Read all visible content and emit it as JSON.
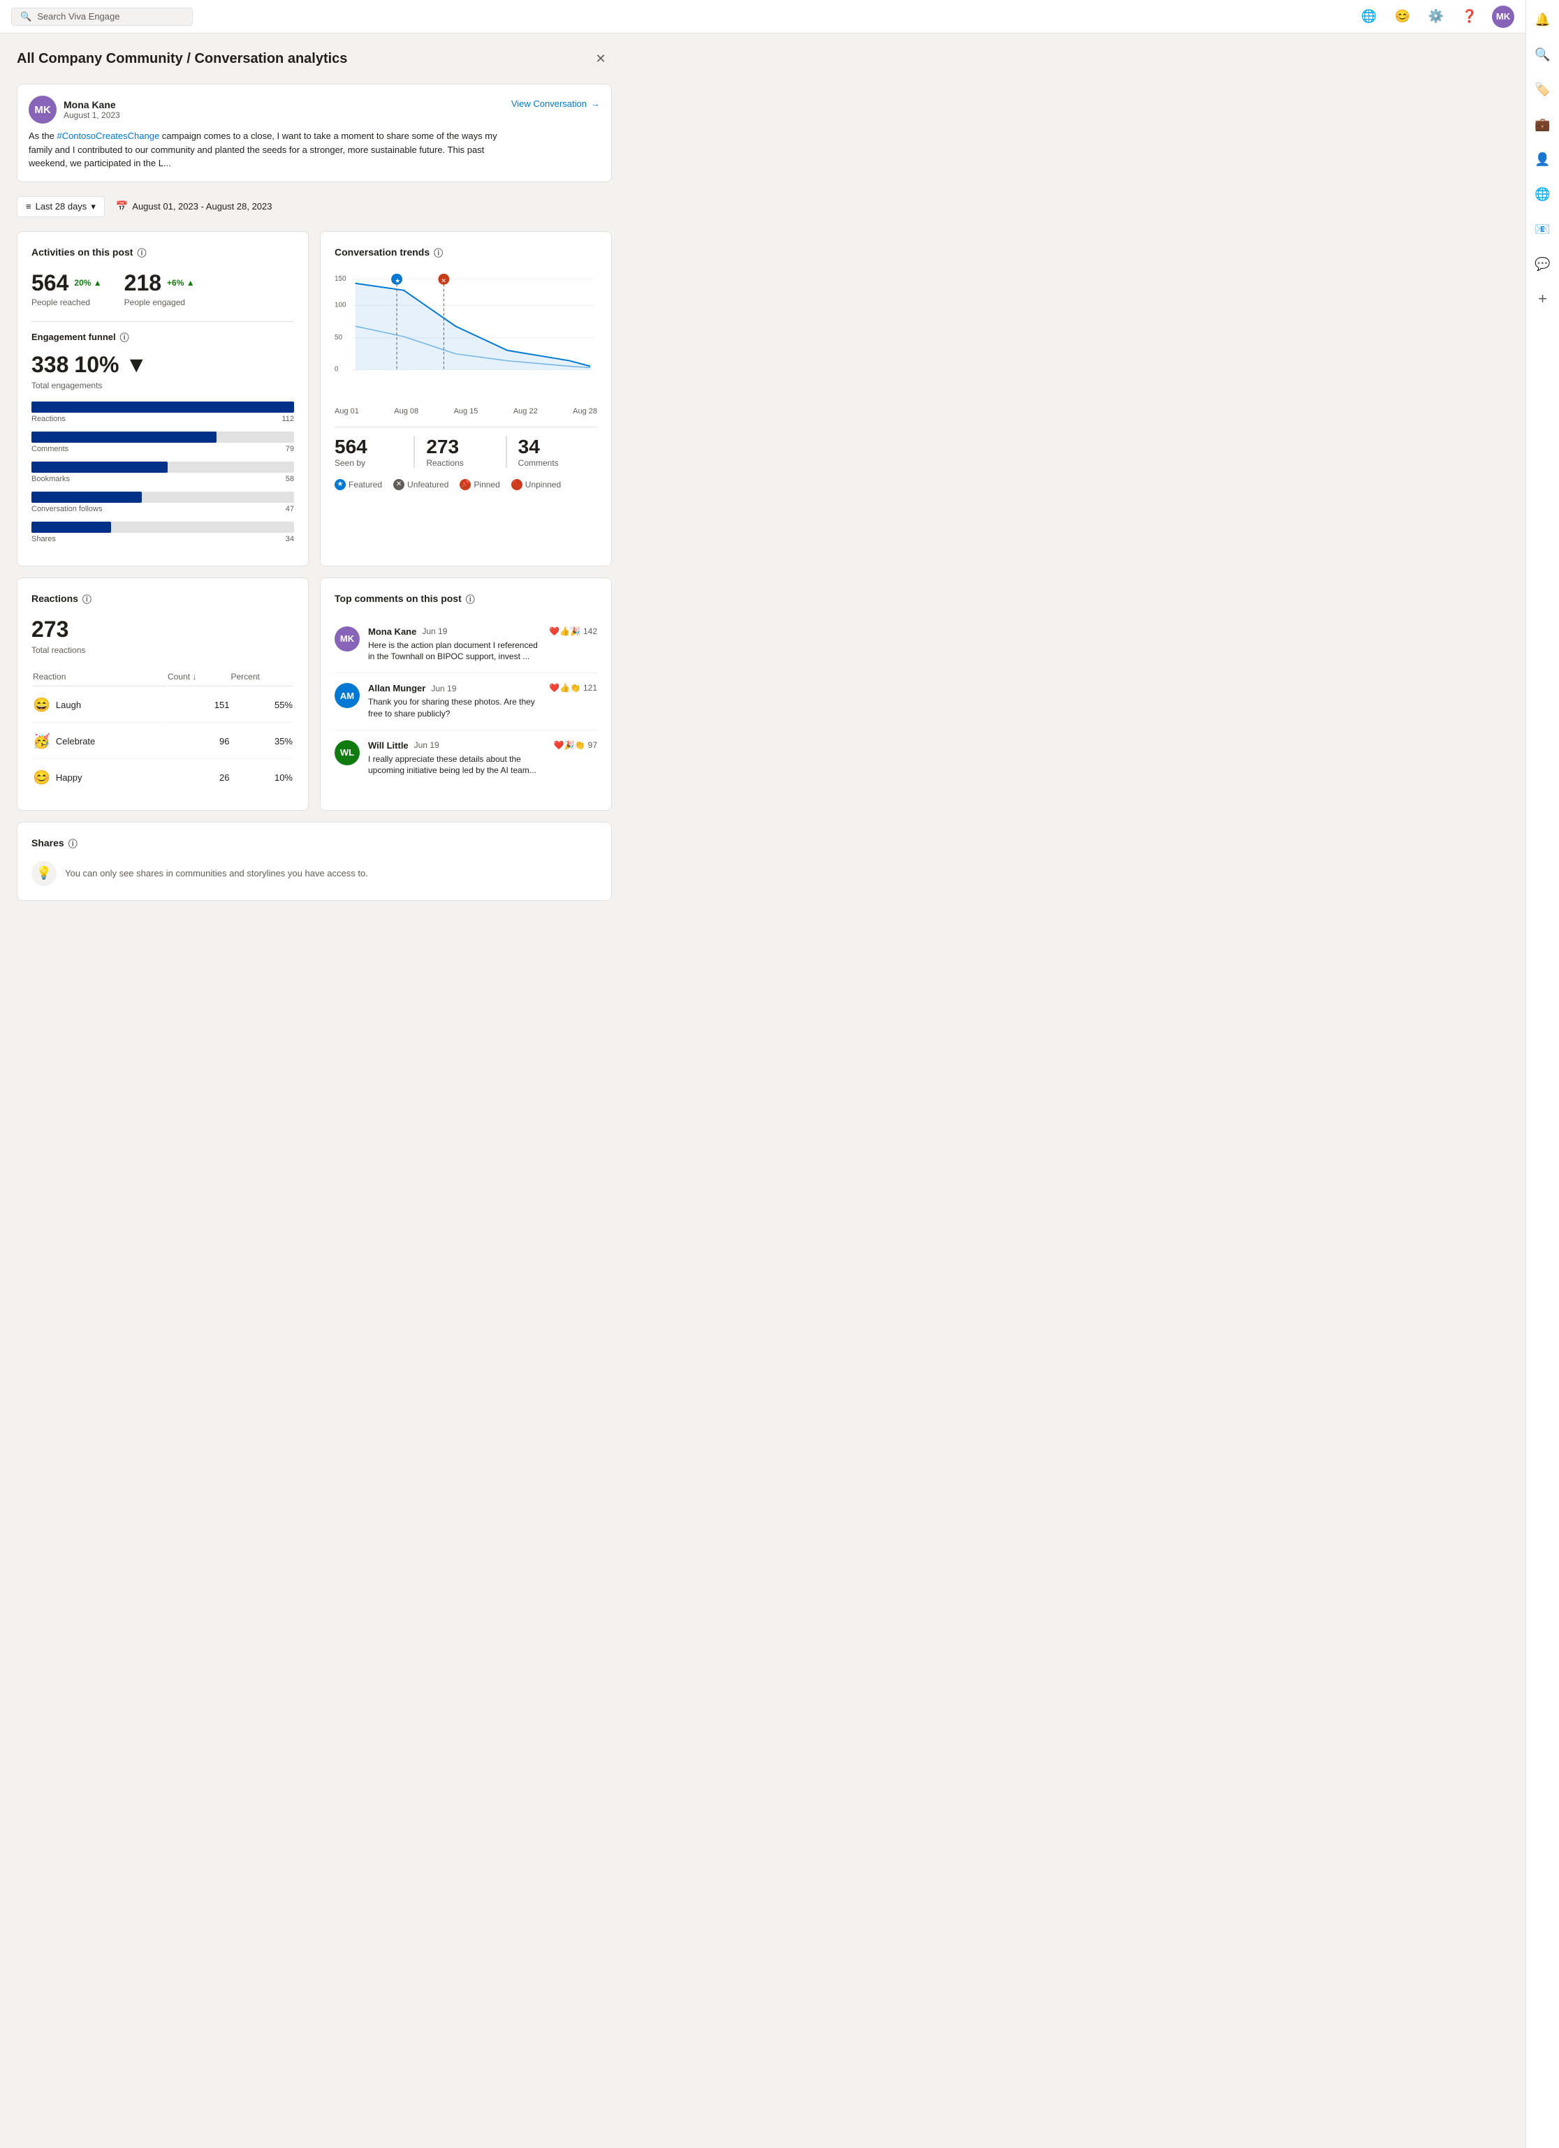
{
  "topNav": {
    "searchPlaceholder": "Search Viva Engage"
  },
  "pageTitle": "All Company Community / Conversation analytics",
  "postCard": {
    "authorName": "Mona Kane",
    "postDate": "August 1, 2023",
    "postText": "As the #ContosoCreatesChange campaign comes to a close, I want to take a moment to share some of the ways my family and I contributed to our community and planted the seeds for a stronger, more sustainable future. This past weekend, we participated in the L...",
    "hashtag": "#ContosoCreatesChange",
    "viewConversationLabel": "View Conversation"
  },
  "filterBar": {
    "periodLabel": "Last 28 days",
    "dateRange": "August 01, 2023 - August 28, 2023"
  },
  "activitiesCard": {
    "title": "Activities on this post",
    "peopleReached": "564",
    "peopleReachedChange": "20%",
    "peopleReachedChangeDir": "up",
    "peopleReachedLabel": "People reached",
    "peopleEngaged": "218",
    "peopleEngagedChange": "+6%",
    "peopleEngagedChangeDir": "up",
    "peopleEngagedLabel": "People engaged",
    "funnelTitle": "Engagement funnel",
    "totalEngagements": "338",
    "totalEngagementsChange": "10%",
    "totalEngagementsChangeDir": "down",
    "totalEngagementsLabel": "Total engagements",
    "bars": [
      {
        "label": "Reactions",
        "value": 112,
        "maxValue": 112,
        "displayValue": "112"
      },
      {
        "label": "Comments",
        "value": 79,
        "maxValue": 112,
        "displayValue": "79"
      },
      {
        "label": "Bookmarks",
        "value": 58,
        "maxValue": 112,
        "displayValue": "58"
      },
      {
        "label": "Conversation follows",
        "value": 47,
        "maxValue": 112,
        "displayValue": "47"
      },
      {
        "label": "Shares",
        "value": 34,
        "maxValue": 112,
        "displayValue": "34"
      }
    ]
  },
  "trendsCard": {
    "title": "Conversation trends",
    "chartLabels": [
      "Aug 01",
      "Aug 08",
      "Aug 15",
      "Aug 22",
      "Aug 28"
    ],
    "chartYLabels": [
      "150",
      "100",
      "50",
      "0"
    ],
    "seenBy": "564",
    "seenByLabel": "Seen by",
    "reactions": "273",
    "reactionsLabel": "Reactions",
    "comments": "34",
    "commentsLabel": "Comments",
    "legend": [
      {
        "type": "featured",
        "label": "Featured",
        "icon": "★"
      },
      {
        "type": "unfeatured",
        "label": "Unfeatured",
        "icon": "✕"
      },
      {
        "type": "pinned",
        "label": "Pinned",
        "icon": "📌"
      },
      {
        "type": "unpinned",
        "label": "Unpinned",
        "icon": "🚫"
      }
    ]
  },
  "reactionsCard": {
    "title": "Reactions",
    "totalReactions": "273",
    "totalReactionsLabel": "Total reactions",
    "tableHeaders": {
      "reaction": "Reaction",
      "count": "Count",
      "percent": "Percent"
    },
    "rows": [
      {
        "emoji": "😄",
        "name": "Laugh",
        "count": "151",
        "percent": "55%"
      },
      {
        "emoji": "🥳",
        "name": "Celebrate",
        "count": "96",
        "percent": "35%"
      },
      {
        "emoji": "😊",
        "name": "Happy",
        "count": "26",
        "percent": "10%"
      }
    ]
  },
  "topCommentsCard": {
    "title": "Top comments on this post",
    "comments": [
      {
        "author": "Mona Kane",
        "date": "Jun 19",
        "text": "Here is the action plan document I referenced in the Townhall on BIPOC support, invest ...",
        "reactions": "❤️👍🎉",
        "reactionCount": "142",
        "avatarColor": "#8764b8",
        "initials": "MK"
      },
      {
        "author": "Allan Munger",
        "date": "Jun 19",
        "text": "Thank you for sharing these photos. Are they free to share publicly?",
        "reactions": "❤️👍👏",
        "reactionCount": "121",
        "avatarColor": "#0078d4",
        "initials": "AM"
      },
      {
        "author": "Will Little",
        "date": "Jun 19",
        "text": "I really appreciate these details about the upcoming initiative being led by the AI team...",
        "reactions": "❤️🎉👏",
        "reactionCount": "97",
        "avatarColor": "#107c10",
        "initials": "WL"
      }
    ]
  },
  "sharesCard": {
    "title": "Shares",
    "noticeText": "You can only see shares in communities and storylines you have access to."
  },
  "rightSidebar": {
    "icons": [
      {
        "name": "bell-icon",
        "symbol": "🔔",
        "active": true
      },
      {
        "name": "search-icon",
        "symbol": "🔍",
        "active": false
      },
      {
        "name": "tag-icon",
        "symbol": "🏷️",
        "active": false
      },
      {
        "name": "briefcase-icon",
        "symbol": "💼",
        "active": false
      },
      {
        "name": "people-icon",
        "symbol": "👤",
        "active": false
      },
      {
        "name": "globe-icon",
        "symbol": "🌐",
        "active": false
      },
      {
        "name": "chat-icon",
        "symbol": "💬",
        "active": false
      },
      {
        "name": "add-icon",
        "symbol": "+",
        "active": false
      }
    ]
  }
}
